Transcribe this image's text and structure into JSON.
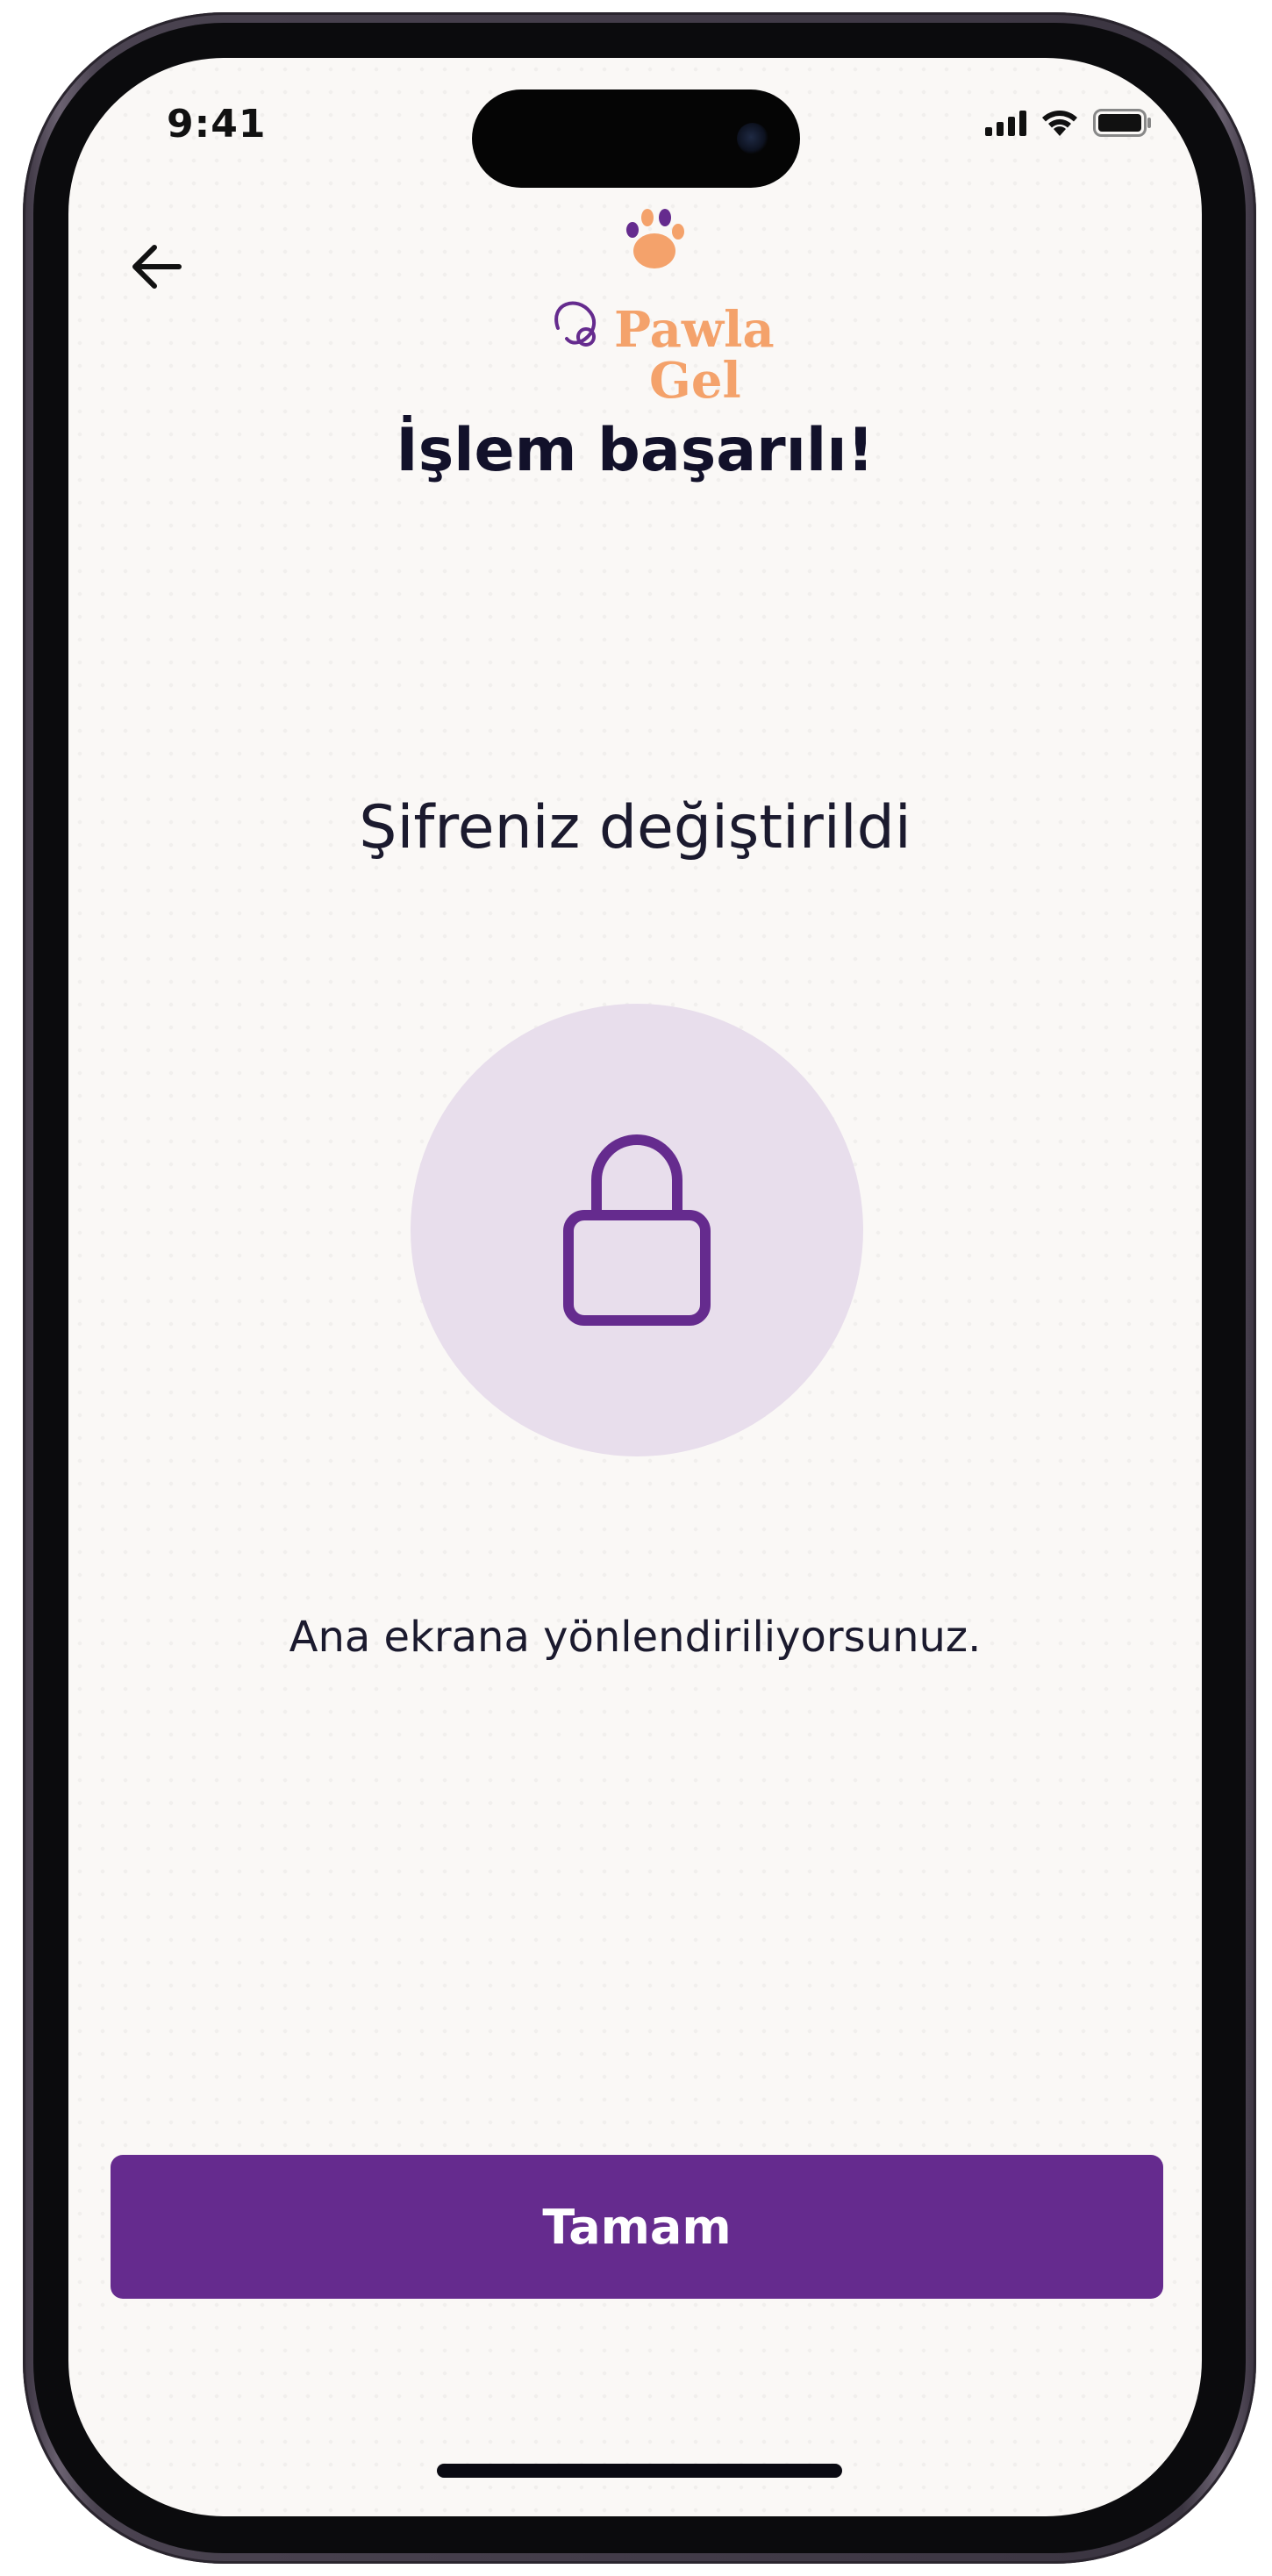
{
  "status_bar": {
    "time": "9:41"
  },
  "header": {
    "back_icon": "arrow-left-icon",
    "logo": {
      "line1": "Pawla",
      "line2": "Gel"
    }
  },
  "main": {
    "title": "İşlem başarılı!",
    "subtitle": "Şifreniz değiştirildi",
    "illustration_icon": "lock-icon",
    "info": "Ana ekrana yönlendiriliyorsunuz."
  },
  "footer": {
    "confirm_label": "Tamam"
  },
  "colors": {
    "primary": "#652B8E",
    "circle_bg": "#E8DEEC",
    "logo_orange": "#F4A26B",
    "text_dark": "#12112A",
    "screen_bg": "#FAF8F6"
  }
}
